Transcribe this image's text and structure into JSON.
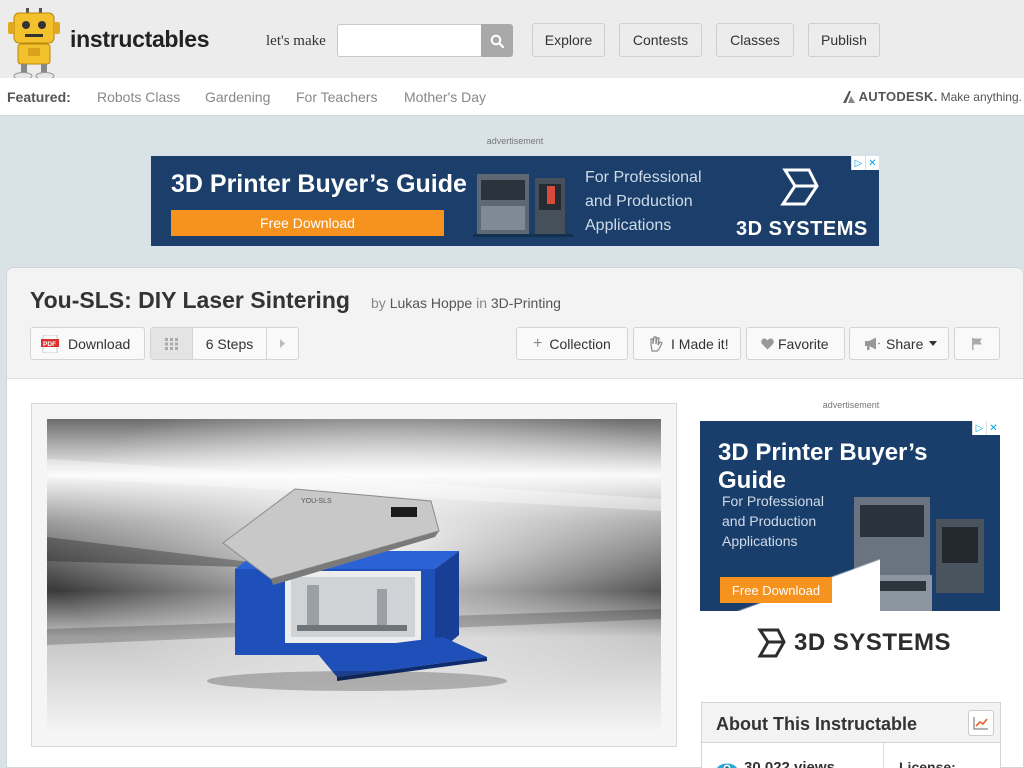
{
  "header": {
    "brand": "instructables",
    "tagline": "let's make",
    "search": {
      "placeholder": "",
      "value": ""
    },
    "nav": [
      {
        "label": "Explore"
      },
      {
        "label": "Contests"
      },
      {
        "label": "Classes"
      },
      {
        "label": "Publish"
      }
    ]
  },
  "featured": {
    "label": "Featured:",
    "links": [
      "Robots Class",
      "Gardening",
      "For Teachers",
      "Mother's Day"
    ],
    "sponsor": {
      "brand": "AUTODESK.",
      "slogan": "Make anything."
    }
  },
  "ads": {
    "label": "advertisement",
    "top": {
      "title": "3D Printer Buyer’s Guide",
      "button": "Free Download",
      "text": [
        "For Professional",
        "and Production",
        "Applications"
      ],
      "brand": "3D SYSTEMS"
    },
    "side": {
      "title": "3D Printer Buyer’s Guide",
      "text": [
        "For Professional",
        "and Production",
        "Applications"
      ],
      "button": "Free Download",
      "brand": "3D SYSTEMS"
    },
    "choices": [
      "▷",
      "✕"
    ]
  },
  "article": {
    "title": "You-SLS: DIY Laser Sintering",
    "by": "by",
    "author": "Lukas Hoppe",
    "in": "in",
    "category": "3D-Printing",
    "toolbar": {
      "download": "Download",
      "steps": "6 Steps",
      "collection": "Collection",
      "made_it": "I Made it!",
      "favorite": "Favorite",
      "share": "Share"
    },
    "hero_label": "YOU-SLS"
  },
  "about": {
    "title": "About This Instructable",
    "views": "30,022 views",
    "license_label": "License:"
  },
  "colors": {
    "ad_background": "#1b3f6a",
    "ad_button": "#f6921e",
    "robot_yellow": "#f3c12b",
    "printer_blue": "#1f4fb8"
  }
}
